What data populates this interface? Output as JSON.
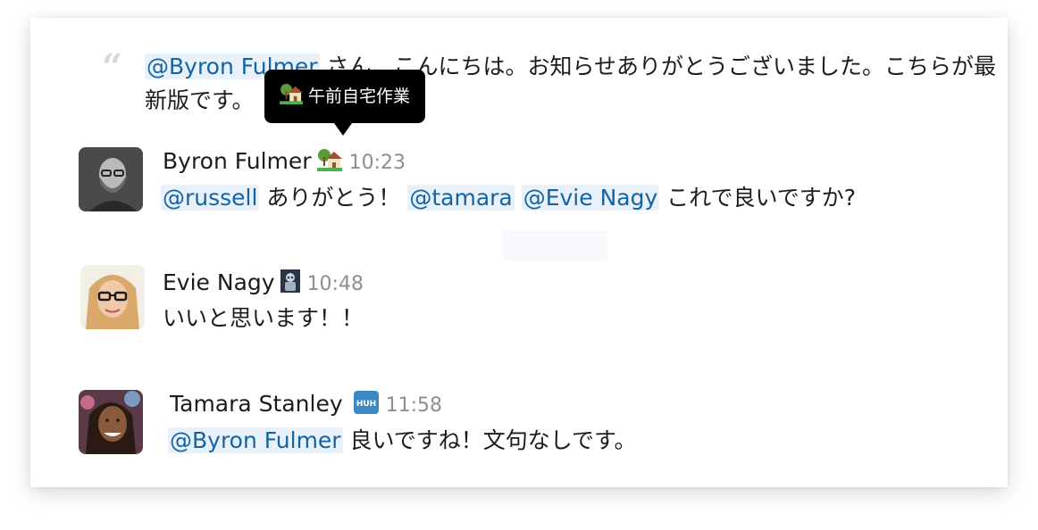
{
  "quote": {
    "mention": "@Byron Fulmer",
    "text": " さん、こんにちは。お知らせありがとうございました。こちらが最新版です。"
  },
  "tooltip": {
    "icon": "house-with-garden-icon",
    "text": "午前自宅作業"
  },
  "messages": [
    {
      "name": "Byron Fulmer",
      "status_icon": "house-with-garden-icon",
      "time": "10:23",
      "mention1": "@russell",
      "text1": " ありがとう！ ",
      "mention2": "@tamara",
      "mention3": "@Evie Nagy",
      "text2": " これで良いですか?"
    },
    {
      "name": "Evie Nagy",
      "status_icon": "robot-icon",
      "time": "10:48",
      "text": "いいと思います！！"
    },
    {
      "name": "Tamara Stanley",
      "status_icon": "huh-icon",
      "status_text": "HUH",
      "time": "11:58",
      "mention": "@Byron Fulmer",
      "text": " 良いですね！文句なしです。"
    }
  ],
  "colors": {
    "mention_text": "#1264a3",
    "mention_bg": "#e8f0fa",
    "timestamp": "#8e8e8e",
    "tooltip_bg": "#000000"
  }
}
